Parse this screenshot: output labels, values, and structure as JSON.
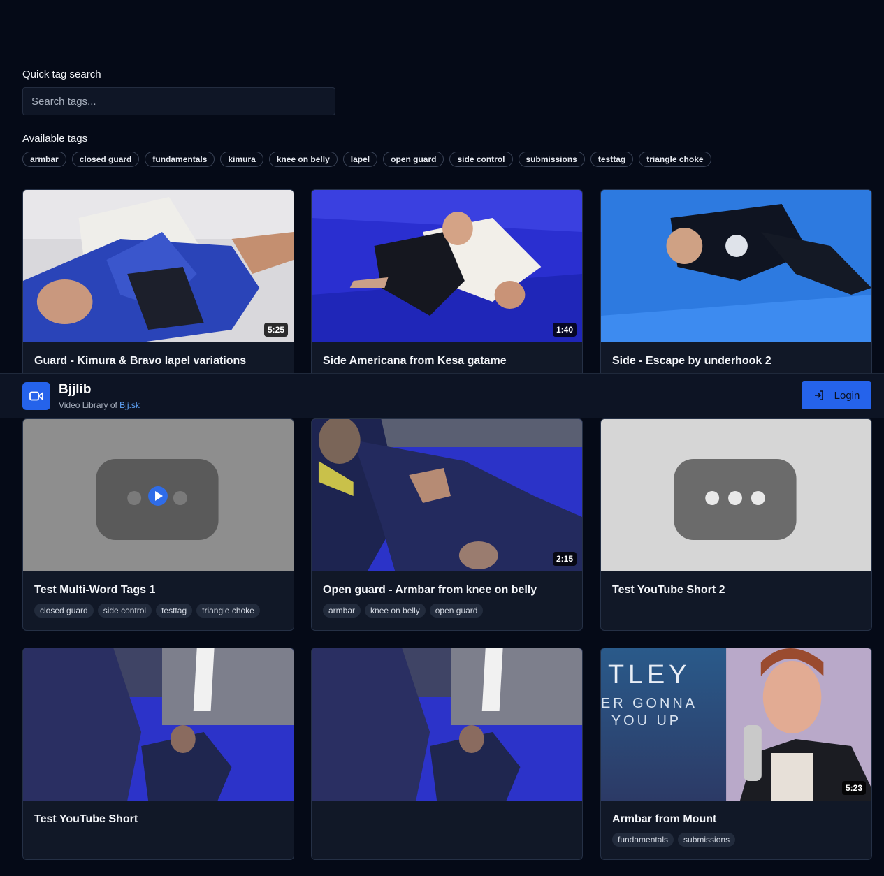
{
  "search": {
    "label": "Quick tag search",
    "placeholder": "Search tags..."
  },
  "available_tags": {
    "label": "Available tags",
    "tags": [
      "armbar",
      "closed guard",
      "fundamentals",
      "kimura",
      "knee on belly",
      "lapel",
      "open guard",
      "side control",
      "submissions",
      "testtag",
      "triangle choke"
    ]
  },
  "header": {
    "app_name": "Bjjlib",
    "subtitle": "Video Library of ",
    "subtitle_link": "Bjj.sk",
    "login_label": "Login",
    "accent_color": "#2563eb"
  },
  "videos": [
    {
      "title": "Guard - Kimura & Bravo lapel variations",
      "duration": "5:25",
      "tags": []
    },
    {
      "title": "Side Americana from Kesa gatame",
      "duration": "1:40",
      "tags": []
    },
    {
      "title": "Side - Escape by underhook 2",
      "duration": "",
      "tags": []
    },
    {
      "title": "Test Multi-Word Tags 1",
      "duration": "",
      "tags": [
        "closed guard",
        "side control",
        "testtag",
        "triangle choke"
      ]
    },
    {
      "title": "Open guard - Armbar from knee on belly",
      "duration": "2:15",
      "tags": [
        "armbar",
        "knee on belly",
        "open guard"
      ]
    },
    {
      "title": "Test YouTube Short 2",
      "duration": "",
      "tags": []
    },
    {
      "title": "Test YouTube Short",
      "duration": "",
      "tags": []
    },
    {
      "title": "",
      "duration": "",
      "tags": []
    },
    {
      "title": "Armbar from Mount",
      "duration": "5:23",
      "thumb_text": [
        "TLEY",
        "ER GONNA",
        "YOU UP"
      ],
      "tags": [
        "fundamentals",
        "submissions"
      ]
    }
  ]
}
